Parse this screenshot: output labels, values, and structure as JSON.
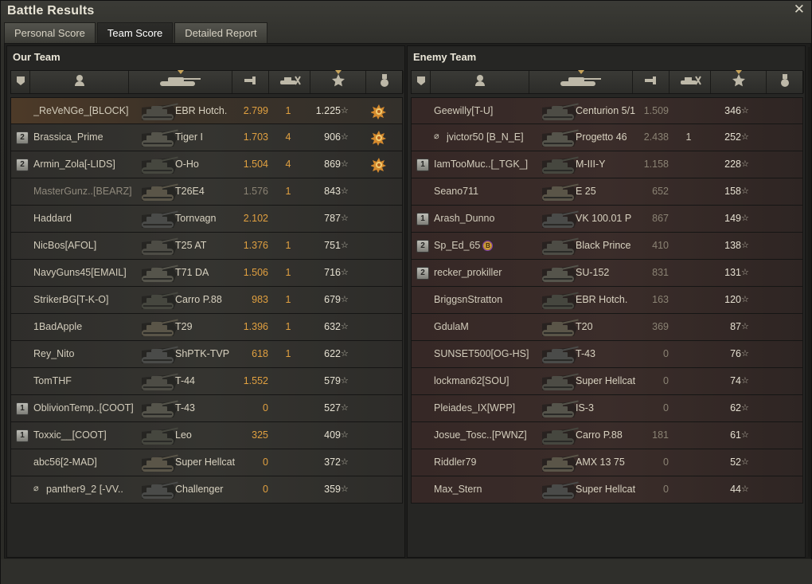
{
  "window": {
    "title": "Battle Results",
    "close_icon": "close-icon"
  },
  "tabs": [
    {
      "label": "Personal Score",
      "active": false
    },
    {
      "label": "Team Score",
      "active": true
    },
    {
      "label": "Detailed Report",
      "active": false
    }
  ],
  "header_icons": [
    "squad-icon",
    "player-icon",
    "tank-icon",
    "damage-icon",
    "kills-icon",
    "xp-star-icon",
    "medal-icon"
  ],
  "our_team": {
    "title": "Our Team",
    "rows": [
      {
        "name": "_ReVeNGe_[BLOCK]",
        "squad": "",
        "tank": "EBR Hotch.",
        "damage": "2.799",
        "kills": "1",
        "xp": "1.225",
        "medal": true,
        "self": true
      },
      {
        "name": "Brassica_Prime",
        "squad": "2",
        "tank": "Tiger I",
        "damage": "1.703",
        "kills": "4",
        "xp": "906",
        "medal": true
      },
      {
        "name": "Armin_Zola[-LIDS]",
        "squad": "2",
        "tank": "O-Ho",
        "damage": "1.504",
        "kills": "4",
        "xp": "869",
        "medal": true
      },
      {
        "name": "MasterGunz..[BEARZ]",
        "squad": "",
        "tank": "T26E4",
        "damage": "1.576",
        "kills": "1",
        "xp": "843",
        "dim": true
      },
      {
        "name": "Haddard",
        "squad": "",
        "tank": "Tornvagn",
        "damage": "2.102",
        "kills": "",
        "xp": "787"
      },
      {
        "name": "NicBos[AFOL]",
        "squad": "",
        "tank": "T25 AT",
        "damage": "1.376",
        "kills": "1",
        "xp": "751"
      },
      {
        "name": "NavyGuns45[EMAIL]",
        "squad": "",
        "tank": "T71 DA",
        "damage": "1.506",
        "kills": "1",
        "xp": "716"
      },
      {
        "name": "StrikerBG[T-K-O]",
        "squad": "",
        "tank": "Carro P.88",
        "damage": "983",
        "kills": "1",
        "xp": "679"
      },
      {
        "name": "1BadApple",
        "squad": "",
        "tank": "T29",
        "damage": "1.396",
        "kills": "1",
        "xp": "632"
      },
      {
        "name": "Rey_Nito",
        "squad": "",
        "tank": "ShPTK-TVP",
        "damage": "618",
        "kills": "1",
        "xp": "622"
      },
      {
        "name": "TomTHF",
        "squad": "",
        "tank": "T-44",
        "damage": "1.552",
        "kills": "",
        "xp": "579"
      },
      {
        "name": "OblivionTemp..[COOT]",
        "squad": "1",
        "tank": "T-43",
        "damage": "0",
        "kills": "",
        "xp": "527"
      },
      {
        "name": "Toxxic__[COOT]",
        "squad": "1",
        "tank": "Leo",
        "damage": "325",
        "kills": "",
        "xp": "409"
      },
      {
        "name": "abc56[2-MAD]",
        "squad": "",
        "tank": "Super Hellcat",
        "damage": "0",
        "kills": "",
        "xp": "372"
      },
      {
        "name": "panther9_2 [-VV..",
        "squad": "",
        "tank": "Challenger",
        "damage": "0",
        "kills": "",
        "xp": "359",
        "offline": true
      }
    ]
  },
  "enemy_team": {
    "title": "Enemy Team",
    "rows": [
      {
        "name": "Geewilly[T-U]",
        "squad": "",
        "tank": "Centurion 5/1",
        "damage": "1.509",
        "kills": "",
        "xp": "346"
      },
      {
        "name": "jvictor50 [B_N_E]",
        "squad": "",
        "tank": "Progetto 46",
        "damage": "2.438",
        "kills": "1",
        "xp": "252",
        "offline": true
      },
      {
        "name": "IamTooMuc..[_TGK_]",
        "squad": "1",
        "tank": "M-III-Y",
        "damage": "1.158",
        "kills": "",
        "xp": "228"
      },
      {
        "name": "Seano711",
        "squad": "",
        "tank": "E 25",
        "damage": "652",
        "kills": "",
        "xp": "158"
      },
      {
        "name": "Arash_Dunno",
        "squad": "1",
        "tank": "VK 100.01 P",
        "damage": "867",
        "kills": "",
        "xp": "149"
      },
      {
        "name": "Sp_Ed_65",
        "squad": "2",
        "tank": "Black Prince",
        "damage": "410",
        "kills": "",
        "xp": "138",
        "badge": "B"
      },
      {
        "name": "recker_prokiller",
        "squad": "2",
        "tank": "SU-152",
        "damage": "831",
        "kills": "",
        "xp": "131"
      },
      {
        "name": "BriggsnStratton",
        "squad": "",
        "tank": "EBR Hotch.",
        "damage": "163",
        "kills": "",
        "xp": "120"
      },
      {
        "name": "GdulaM",
        "squad": "",
        "tank": "T20",
        "damage": "369",
        "kills": "",
        "xp": "87"
      },
      {
        "name": "SUNSET500[OG-HS]",
        "squad": "",
        "tank": "T-43",
        "damage": "0",
        "kills": "",
        "xp": "76"
      },
      {
        "name": "lockman62[SOU]",
        "squad": "",
        "tank": "Super Hellcat",
        "damage": "0",
        "kills": "",
        "xp": "74"
      },
      {
        "name": "Pleiades_IX[WPP]",
        "squad": "",
        "tank": "IS-3",
        "damage": "0",
        "kills": "",
        "xp": "62"
      },
      {
        "name": "Josue_Tosc..[PWNZ]",
        "squad": "",
        "tank": "Carro P.88",
        "damage": "181",
        "kills": "",
        "xp": "61"
      },
      {
        "name": "Riddler79",
        "squad": "",
        "tank": "AMX 13 75",
        "damage": "0",
        "kills": "",
        "xp": "52"
      },
      {
        "name": "Max_Stern",
        "squad": "",
        "tank": "Super Hellcat",
        "damage": "0",
        "kills": "",
        "xp": "44"
      }
    ]
  },
  "colors": {
    "damage": "#e0a040",
    "kills": "#e0a040",
    "self_row": "#4d3a28",
    "enemy_row": "#3b2d2a"
  }
}
